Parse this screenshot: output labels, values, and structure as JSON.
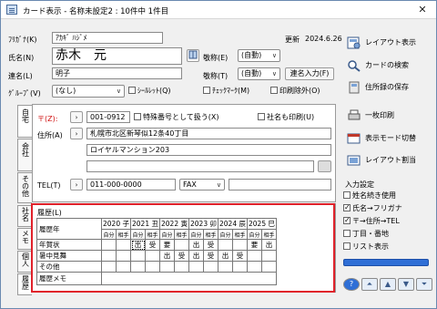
{
  "window": {
    "title": "カード表示 - 名称未設定2 : 10件中 1件目",
    "close_glyph": "✕"
  },
  "furigana": {
    "label": "ﾌﾘｶﾞﾅ(K)",
    "value": "ｱｶｷﾞ ﾊｼﾞﾒ"
  },
  "updated": {
    "label": "更新",
    "value": "2024.6.26"
  },
  "name": {
    "label": "氏名(N)",
    "value": "赤木　元",
    "honorific_label": "敬称(E)",
    "honorific_value": "(自動)"
  },
  "joint": {
    "label": "連名(L)",
    "value": "明子",
    "honorific_label": "敬称(T)",
    "honorific_value": "(自動)",
    "button": "連名入力(F)"
  },
  "group": {
    "label": "ｸﾞﾙｰﾌﾟ(V)",
    "value": "(なし)",
    "check_seal": "ｼｰﾙﾚｯﾄ(Q)",
    "check_mark": "ﾁｪｯｸﾏｰｸ(M)",
    "check_noprint": "印刷除外(O)"
  },
  "tabs_left": [
    "自宅",
    "会社",
    "その他"
  ],
  "tabs_left_bottom": [
    "社名",
    "メモ",
    "個人",
    "履歴"
  ],
  "address": {
    "zip_label": "〒(Z):",
    "zip_value": "001-0912",
    "special_zip": "特殊番号として扱う(X)",
    "company_print": "社名も印刷(U)",
    "addr_label": "住所(A)",
    "addr1": "札幌市北区新琴似12条40丁目",
    "addr2": "ロイヤルマンション203",
    "addr3": "",
    "tel_label": "TEL(T)",
    "tel_value": "011-000-0000",
    "fax_label": "FAX",
    "fax_value": ""
  },
  "history": {
    "title": "履歴(L)",
    "header_label": "履歴年",
    "years": [
      "2020 子",
      "2021 丑",
      "2022 寅",
      "2023 卯",
      "2024 辰",
      "2025 巳"
    ],
    "sub_self": "自分",
    "sub_other": "相手",
    "rows": [
      {
        "label": "年賀状",
        "cells": [
          "",
          "",
          "出",
          "受",
          "要",
          "",
          "出",
          "受",
          "",
          "",
          "要",
          "出",
          "受",
          "",
          "",
          ""
        ]
      },
      {
        "label": "暑中見舞",
        "cells": [
          "",
          "",
          "",
          "",
          "出",
          "受",
          "出",
          "受",
          "出",
          "受",
          "",
          "",
          "",
          "",
          "",
          ""
        ]
      },
      {
        "label": "その他",
        "cells": [
          "",
          "",
          "",
          "",
          "",
          "",
          "",
          "",
          "",
          "",
          "",
          "",
          "",
          "",
          "",
          ""
        ]
      },
      {
        "label": "履歴メモ",
        "cells": []
      }
    ]
  },
  "right_panel": {
    "layout_view": "レイアウト表示",
    "card_search": "カードの検索",
    "save_address": "住所録の保存",
    "single_print": "一枚印刷",
    "view_mode": "表示モード切替",
    "layout_split": "レイアウト割当",
    "input_settings": "入力設定",
    "checks": [
      {
        "label": "姓名続き使用",
        "checked": false
      },
      {
        "label": "氏名→フリガナ",
        "checked": true
      },
      {
        "label": "〒→住所→TEL",
        "checked": true
      },
      {
        "label": "丁目・番地",
        "checked": false
      },
      {
        "label": "リスト表示",
        "checked": false
      }
    ]
  },
  "nav": {
    "help": "?",
    "first": "⏶",
    "prev": "▲",
    "next": "▼",
    "last": "⏷"
  },
  "colors": {
    "accent_red": "#e0212a",
    "progress_blue": "#2f6fd6"
  }
}
